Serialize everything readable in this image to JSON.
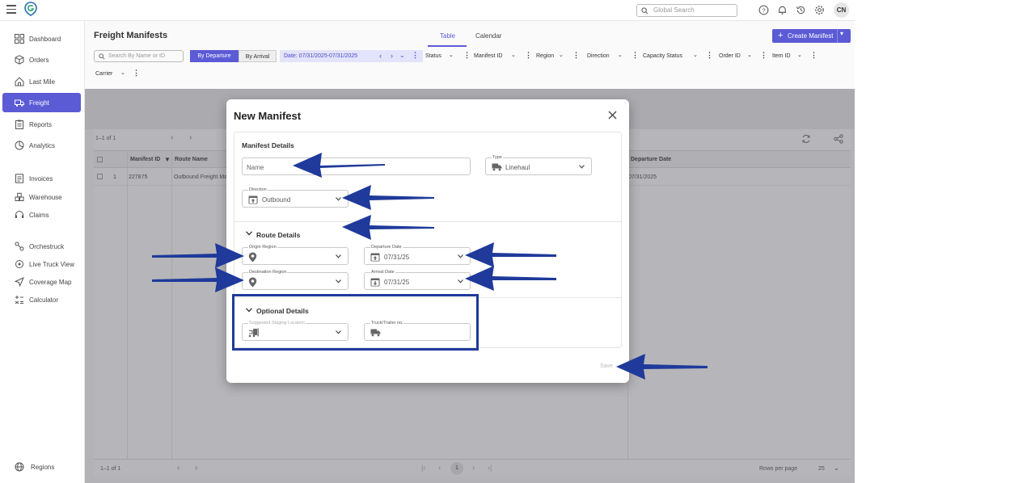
{
  "header": {
    "search_placeholder": "Global Search",
    "avatar_initials": "CN"
  },
  "sidebar": {
    "items": [
      {
        "label": "Dashboard",
        "icon": "grid-icon"
      },
      {
        "label": "Orders",
        "icon": "box-icon"
      },
      {
        "label": "Last Mile",
        "icon": "house-icon"
      },
      {
        "label": "Freight",
        "icon": "truck-icon"
      },
      {
        "label": "Reports",
        "icon": "clipboard-icon"
      },
      {
        "label": "Analytics",
        "icon": "analytics-icon"
      },
      {
        "label": "Invoices",
        "icon": "invoice-icon"
      },
      {
        "label": "Warehouse",
        "icon": "warehouse-icon"
      },
      {
        "label": "Claims",
        "icon": "headset-icon"
      },
      {
        "label": "Orchestruck",
        "icon": "orchestruck-icon"
      },
      {
        "label": "Live Truck View",
        "icon": "target-icon"
      },
      {
        "label": "Coverage Map",
        "icon": "send-icon"
      },
      {
        "label": "Calculator",
        "icon": "calculator-icon"
      },
      {
        "label": "Regions",
        "icon": "globe-icon"
      }
    ],
    "active": "Freight"
  },
  "page": {
    "title": "Freight Manifests",
    "tabs": [
      {
        "label": "Table"
      },
      {
        "label": "Calendar"
      }
    ],
    "active_tab": "Table",
    "create_button": "Create Manifest"
  },
  "filters": {
    "search_placeholder": "Search By Name or ID",
    "by_departure": "By Departure",
    "by_arrival": "By Arrival",
    "date_range": "Date: 07/31/2025-07/31/2025",
    "chips": [
      "Status",
      "Manifest ID",
      "Region",
      "Direction",
      "Capacity Status",
      "Order ID",
      "Item ID",
      "Carrier"
    ]
  },
  "table": {
    "pagination_top": "1–1 of 1",
    "columns": [
      "Manifest ID",
      "Route Name",
      "Departure Date"
    ],
    "rows": [
      {
        "index": "1",
        "manifest_id": "227875",
        "route_name": "Outbound Freight Ma",
        "departure_date": "07/31/2025"
      }
    ],
    "pagination_bottom": "1–1 of 1",
    "current_page": "1",
    "rows_per_page_label": "Rows per page",
    "rows_per_page": "25"
  },
  "modal": {
    "title": "New Manifest",
    "manifest_details": {
      "heading": "Manifest Details",
      "name_placeholder": "Name",
      "type_label": "Type",
      "type_value": "Linehaul",
      "direction_label": "Direction",
      "direction_value": "Outbound"
    },
    "route_details": {
      "heading": "Route Details",
      "origin_label": "Origin Region",
      "destination_label": "Destination Region",
      "departure_label": "Departure Date",
      "departure_value": "07/31/25",
      "arrival_label": "Arrival Date",
      "arrival_value": "07/31/25"
    },
    "optional_details": {
      "heading": "Optional Details",
      "staging_label": "Suggested Staging Location",
      "truck_label": "Truck/Trailer no."
    },
    "save_button": "Save"
  },
  "colors": {
    "accent": "#5b5bd6",
    "annotation": "#1f3a9a"
  }
}
